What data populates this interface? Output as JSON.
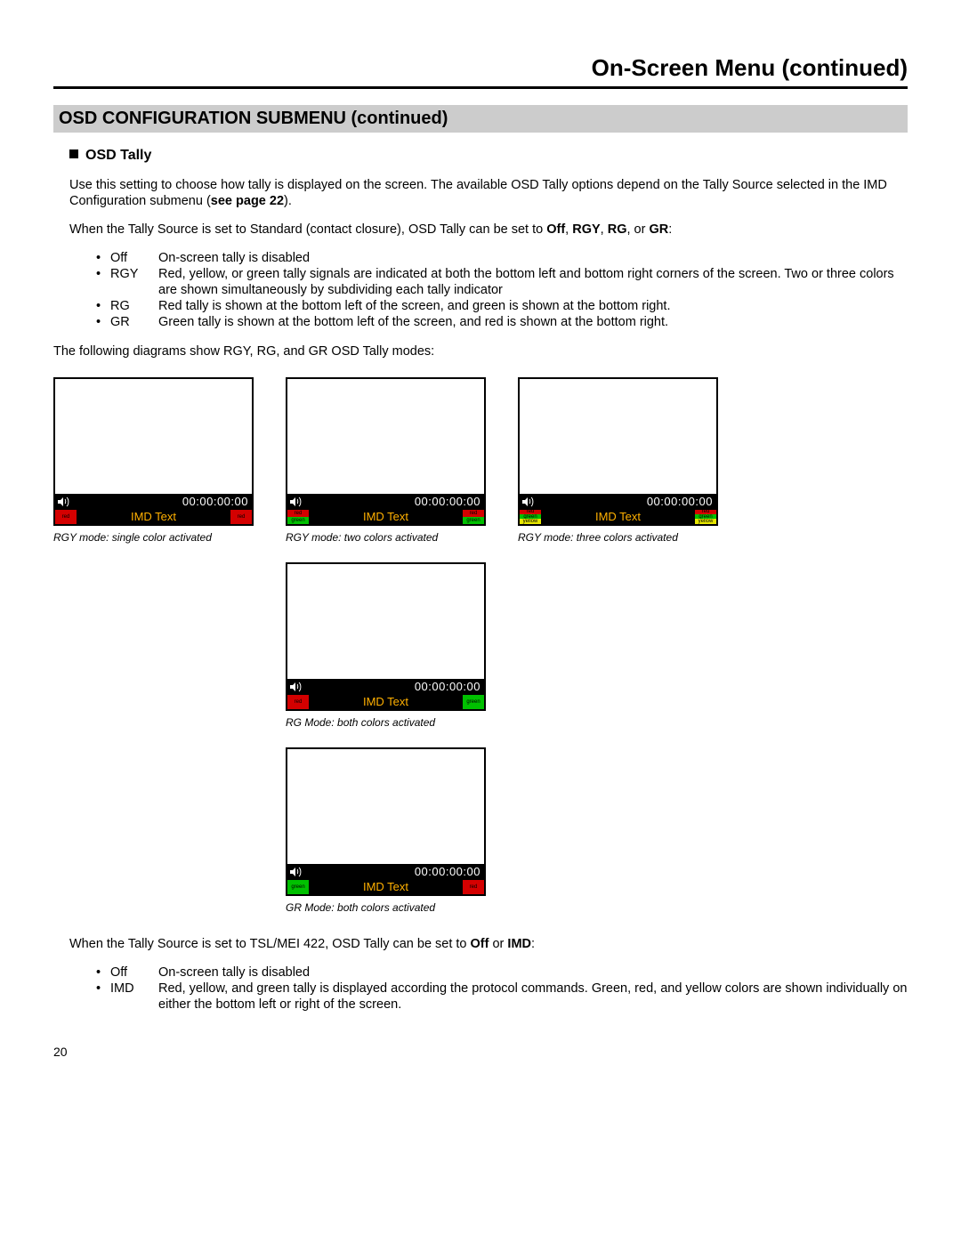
{
  "page_title": "On-Screen Menu (continued)",
  "section_title": "OSD CONFIGURATION SUBMENU (continued)",
  "sub_heading": "OSD Tally",
  "intro": "Use this setting to choose how tally is displayed on the screen.  The available OSD Tally options depend on the Tally Source selected in the IMD Configuration submenu (",
  "see_page": "see page 22",
  "intro_end": ").",
  "standard_line_a": "When the Tally Source is set to Standard (contact closure), OSD Tally can be set to ",
  "std_off": "Off",
  "std_rgy": "RGY",
  "std_rg": "RG",
  "std_or": ", or ",
  "std_gr": "GR",
  "std_colon": ":",
  "defs_std": [
    {
      "term": "Off",
      "text": "On-screen tally is disabled"
    },
    {
      "term": "RGY",
      "text": "Red, yellow, or green tally signals are indicated at both the bottom left and bottom right corners of the screen. Two or three colors are shown simultaneously by subdividing each tally indicator"
    },
    {
      "term": "RG",
      "text": "Red tally is shown at the bottom left of the screen, and green is shown at the bottom right."
    },
    {
      "term": "GR",
      "text": "Green tally is shown at the bottom left of the screen, and red is shown at the bottom right."
    }
  ],
  "diagram_note": "The following diagrams show RGY, RG, and GR OSD Tally modes:",
  "timecode": "00:00:00:00",
  "imd_text": "IMD Text",
  "captions": {
    "rgy1": "RGY mode: single color activated",
    "rgy2": "RGY mode: two colors activated",
    "rgy3": "RGY mode: three colors activated",
    "rg": "RG Mode: both colors activated",
    "gr": "GR Mode: both colors activated"
  },
  "tsl_line_a": "When the Tally Source is set to TSL/MEI 422, OSD Tally can be set to ",
  "tsl_off": "Off",
  "tsl_or": " or ",
  "tsl_imd": "IMD",
  "defs_tsl": [
    {
      "term": "Off",
      "text": "On-screen tally is disabled"
    },
    {
      "term": "IMD",
      "text": "Red, yellow, and green tally is displayed according the protocol commands. Green, red, and yellow colors are shown individually on either the bottom left or right of the screen."
    }
  ],
  "page_number": "20",
  "tally_labels": {
    "red": "red",
    "green": "green",
    "yellow": "yellow"
  }
}
